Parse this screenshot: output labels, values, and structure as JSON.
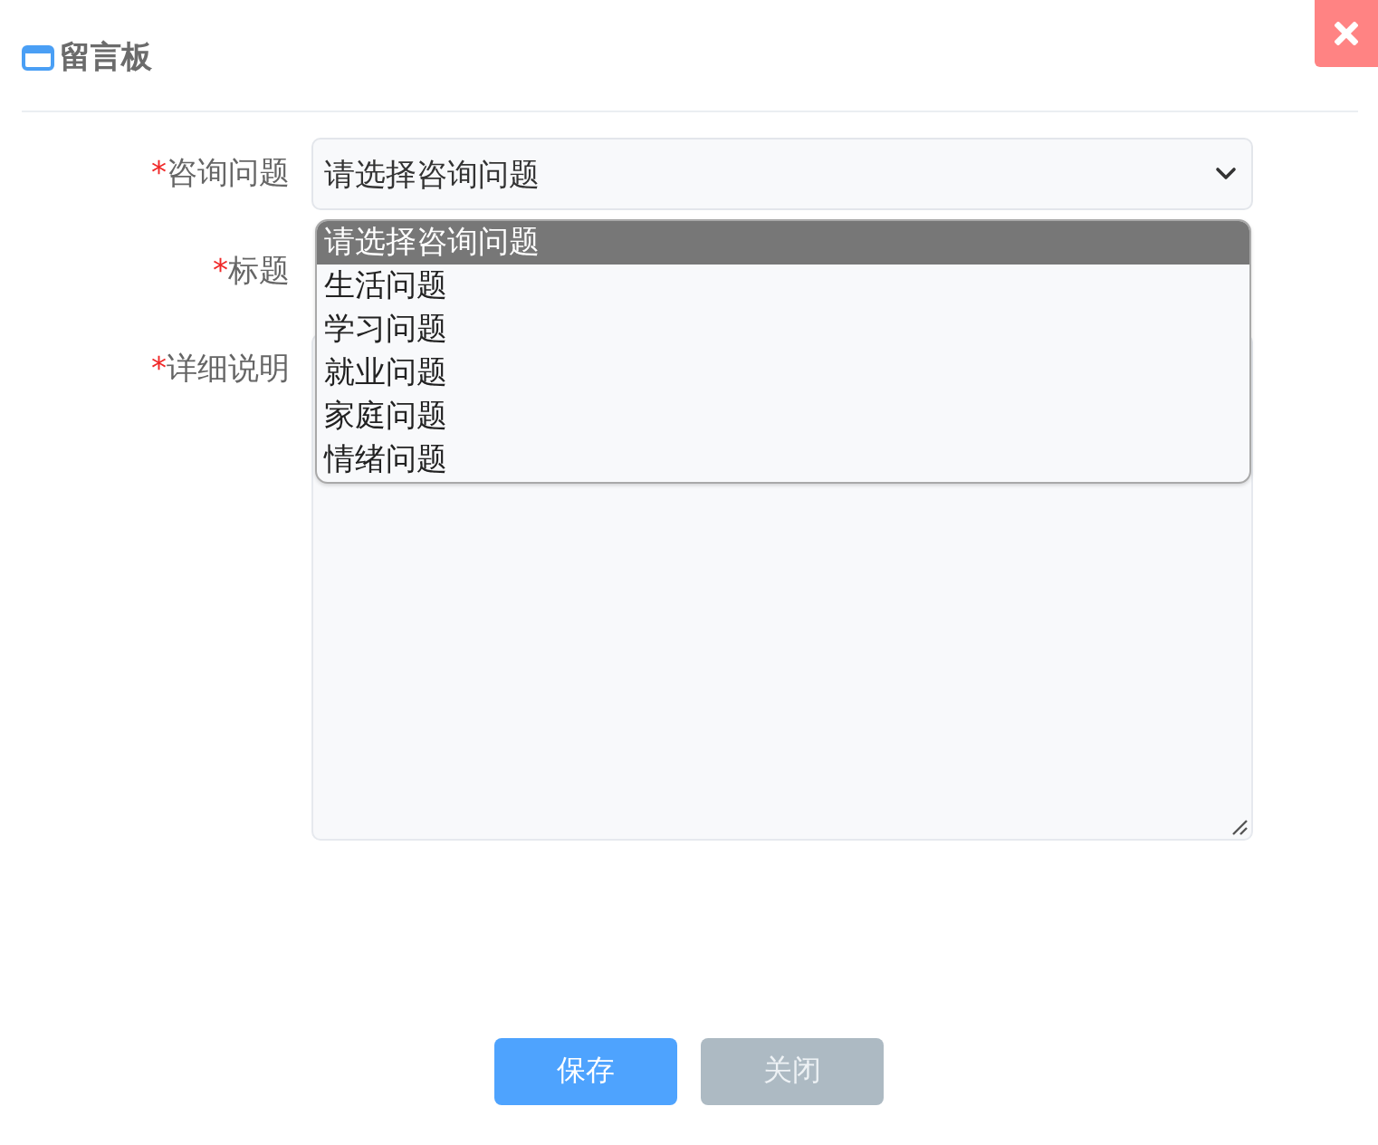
{
  "dialog": {
    "title": "留言板"
  },
  "form": {
    "fields": [
      {
        "kind": "select",
        "required": true,
        "mark": "*",
        "label": "咨询问题",
        "value": "请选择咨询问题",
        "expanded": true,
        "options": [
          {
            "label": "请选择咨询问题",
            "selected": true
          },
          {
            "label": "生活问题",
            "selected": false
          },
          {
            "label": "学习问题",
            "selected": false
          },
          {
            "label": "就业问题",
            "selected": false
          },
          {
            "label": "家庭问题",
            "selected": false
          },
          {
            "label": "情绪问题",
            "selected": false
          }
        ]
      },
      {
        "kind": "input",
        "required": true,
        "mark": "*",
        "label": "标题"
      },
      {
        "kind": "textarea",
        "required": true,
        "mark": "*",
        "label": "详细说明"
      }
    ]
  },
  "buttons": [
    {
      "label": "保存",
      "kind": "primary"
    },
    {
      "label": "关闭",
      "kind": "secondary"
    }
  ]
}
